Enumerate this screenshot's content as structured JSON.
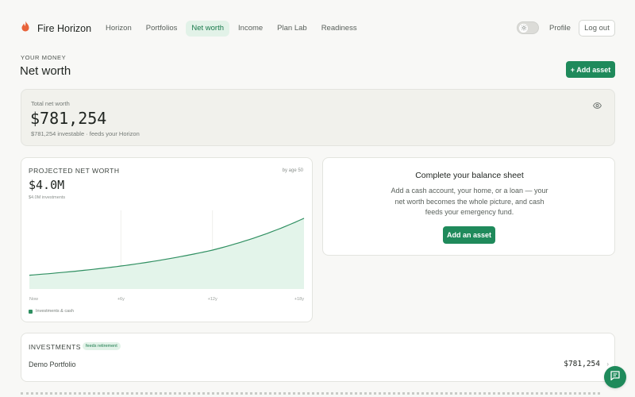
{
  "header": {
    "brand": "Fire Horizon",
    "nav": [
      {
        "label": "Horizon"
      },
      {
        "label": "Portfolios"
      },
      {
        "label": "Net worth",
        "active": true
      },
      {
        "label": "Income"
      },
      {
        "label": "Plan Lab"
      },
      {
        "label": "Readiness"
      }
    ],
    "profile_label": "Profile",
    "logout_label": "Log out"
  },
  "page": {
    "eyebrow": "YOUR MONEY",
    "title": "Net worth",
    "add_asset_label": "+ Add asset"
  },
  "total": {
    "label": "Total net worth",
    "value": "$781,254",
    "sub": "$781,254 investable · feeds your Horizon"
  },
  "projection": {
    "title": "PROJECTED NET WORTH",
    "age_note": "by age 50",
    "value": "$4.0M",
    "sub": "$4.0M   investments",
    "legend": "Investments & cash",
    "chart_data": {
      "type": "area",
      "x": [
        "Now",
        "+6y",
        "+12y",
        "+18y"
      ],
      "series": [
        {
          "name": "Investments & cash",
          "values": [
            0.78,
            1.3,
            2.2,
            4.0
          ]
        }
      ]
    }
  },
  "balance": {
    "title": "Complete your balance sheet",
    "body": "Add a cash account, your home, or a loan — your net worth becomes the whole picture, and cash feeds your emergency fund.",
    "button_label": "Add an asset"
  },
  "investments": {
    "title": "INVESTMENTS",
    "badge": "feeds retirement",
    "rows": [
      {
        "name": "Demo Portfolio",
        "value": "$781,254"
      }
    ]
  },
  "colors": {
    "accent": "#1f8a5b",
    "accent_soft": "#e2f2e8",
    "chart_fill": "#e3f4ea",
    "chart_line": "#2f8f61"
  }
}
